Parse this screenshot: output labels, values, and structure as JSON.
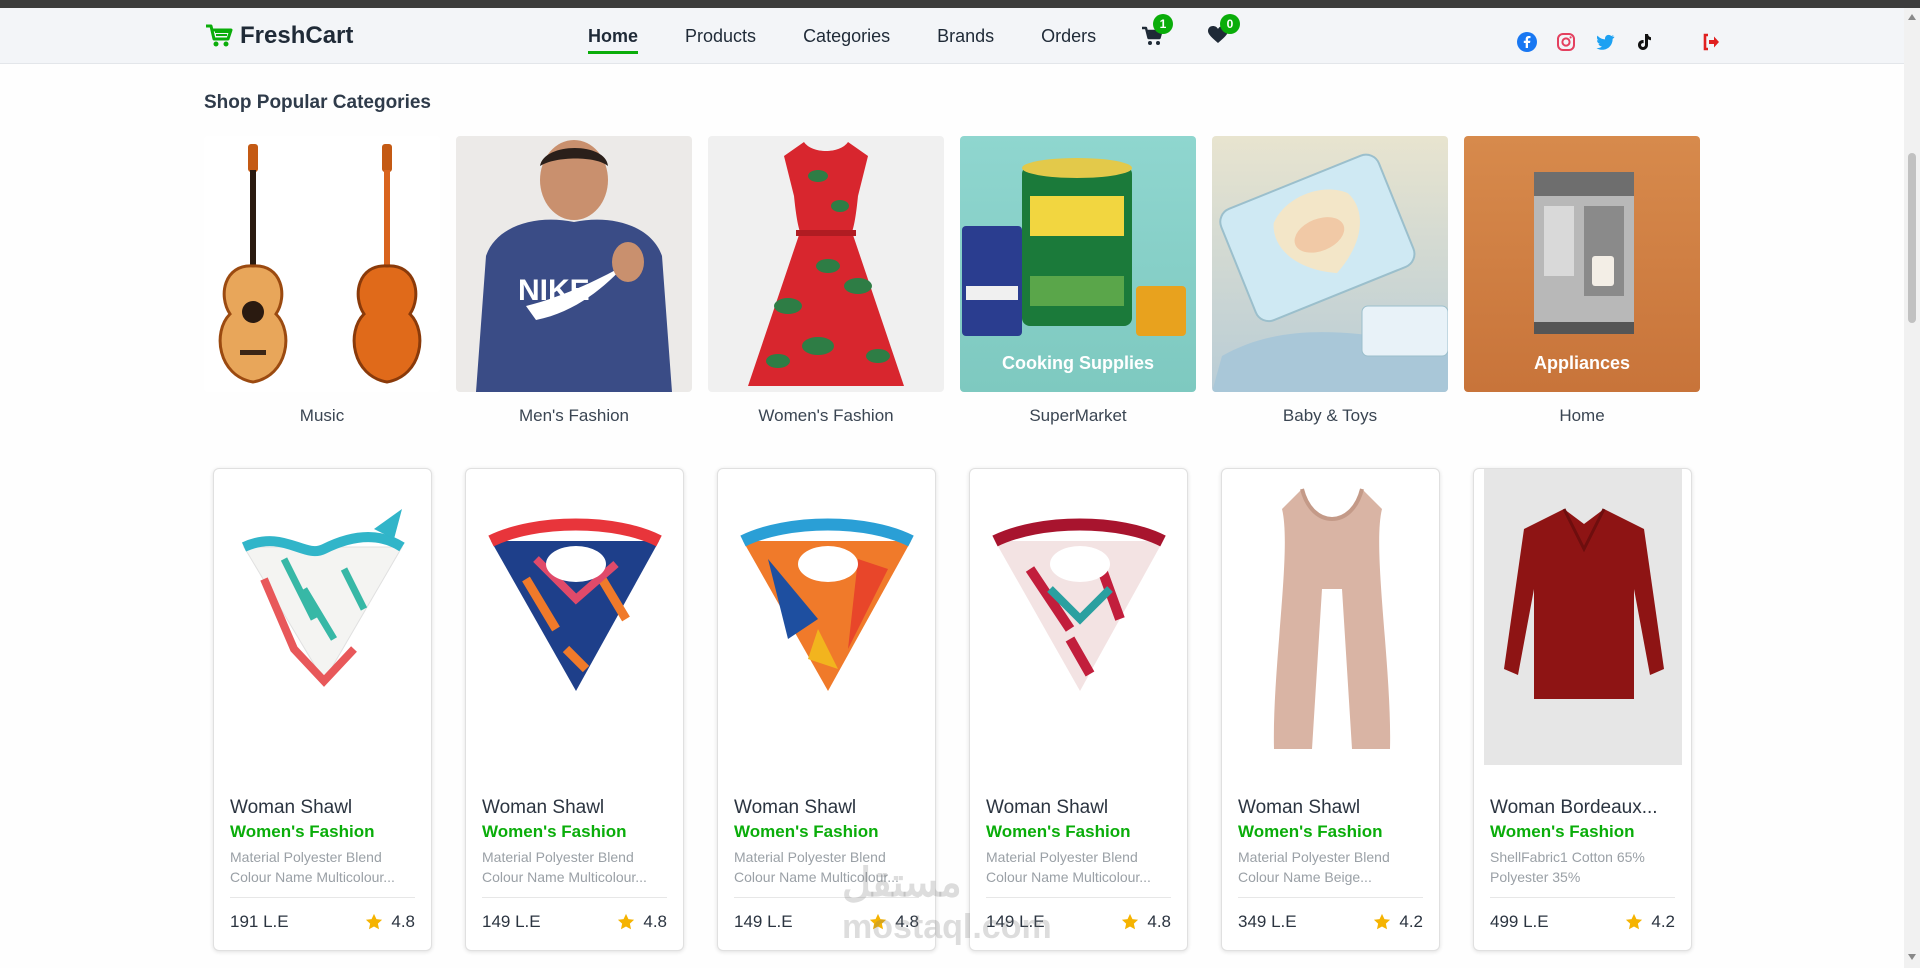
{
  "app": {
    "brand": "FreshCart",
    "brand_color": "#0aad0a"
  },
  "nav": {
    "links": [
      {
        "label": "Home",
        "active": true
      },
      {
        "label": "Products",
        "active": false
      },
      {
        "label": "Categories",
        "active": false
      },
      {
        "label": "Brands",
        "active": false
      },
      {
        "label": "Orders",
        "active": false
      }
    ],
    "cart_count": "1",
    "wishlist_count": "0"
  },
  "socials": [
    "facebook-icon",
    "instagram-icon",
    "twitter-icon",
    "tiktok-icon"
  ],
  "section_title": "Shop Popular Categories",
  "categories": [
    {
      "label": "Music",
      "overlay": ""
    },
    {
      "label": "Men's Fashion",
      "overlay": ""
    },
    {
      "label": "Women's Fashion",
      "overlay": ""
    },
    {
      "label": "SuperMarket",
      "overlay": "Cooking Supplies"
    },
    {
      "label": "Baby & Toys",
      "overlay": ""
    },
    {
      "label": "Home",
      "overlay": "Appliances"
    }
  ],
  "products": [
    {
      "title": "Woman Shawl",
      "category": "Women's Fashion",
      "desc1": "Material Polyester Blend",
      "desc2": "Colour Name Multicolour...",
      "price": "191 L.E",
      "rating": "4.8"
    },
    {
      "title": "Woman Shawl",
      "category": "Women's Fashion",
      "desc1": "Material Polyester Blend",
      "desc2": "Colour Name Multicolour...",
      "price": "149 L.E",
      "rating": "4.8"
    },
    {
      "title": "Woman Shawl",
      "category": "Women's Fashion",
      "desc1": "Material Polyester Blend",
      "desc2": "Colour Name Multicolour...",
      "price": "149 L.E",
      "rating": "4.8"
    },
    {
      "title": "Woman Shawl",
      "category": "Women's Fashion",
      "desc1": "Material Polyester Blend",
      "desc2": "Colour Name Multicolour...",
      "price": "149 L.E",
      "rating": "4.8"
    },
    {
      "title": "Woman Shawl",
      "category": "Women's Fashion",
      "desc1": "Material Polyester Blend",
      "desc2": "Colour Name Beige...",
      "price": "349 L.E",
      "rating": "4.2"
    },
    {
      "title": "Woman Bordeaux...",
      "category": "Women's Fashion",
      "desc1": "ShellFabric1 Cotton 65%",
      "desc2": "Polyester 35%",
      "price": "499 L.E",
      "rating": "4.2"
    }
  ],
  "watermark": {
    "line1": "مستقل",
    "line2": "mostaql.com"
  }
}
